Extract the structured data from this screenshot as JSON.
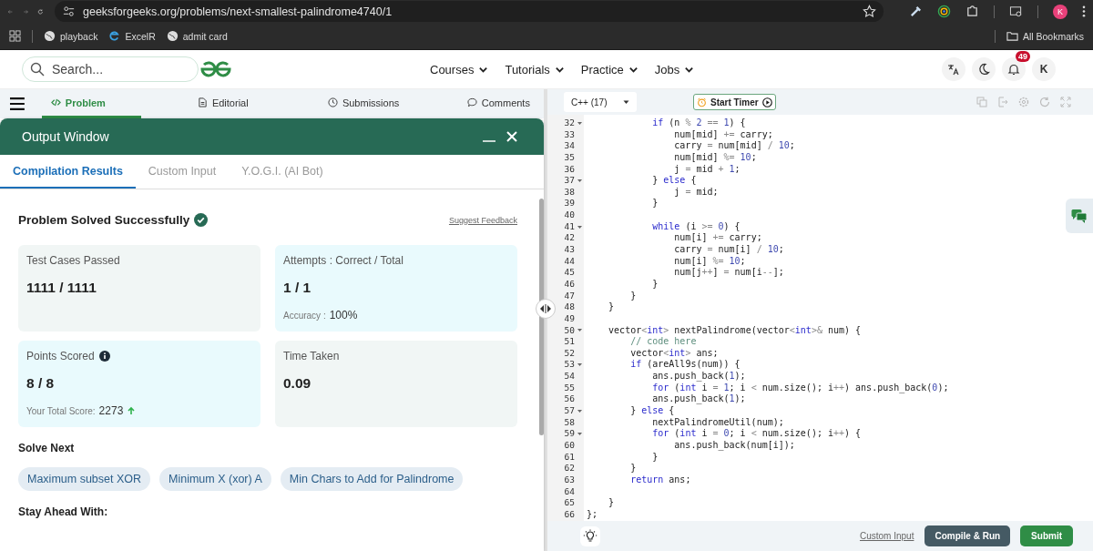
{
  "browser": {
    "url": "geeksforgeeks.org/problems/next-smallest-palindrome4740/1",
    "profile": "K",
    "bookmarks": [
      {
        "label": "playback",
        "kind": "globe"
      },
      {
        "label": "ExcelR",
        "kind": "site"
      },
      {
        "label": "admit card",
        "kind": "globe"
      }
    ],
    "all_bookmarks": "All Bookmarks"
  },
  "header": {
    "search": {
      "placeholder": "Search..."
    },
    "nav": [
      "Courses",
      "Tutorials",
      "Practice",
      "Jobs"
    ],
    "notifications": "49",
    "avatar": "K"
  },
  "problem_tabs": [
    {
      "label": "Problem",
      "kind": "code",
      "selected": true
    },
    {
      "label": "Editorial",
      "kind": "doc",
      "selected": false
    },
    {
      "label": "Submissions",
      "kind": "clock",
      "selected": false
    },
    {
      "label": "Comments",
      "kind": "chat",
      "selected": false
    }
  ],
  "output_window": {
    "title": "Output Window",
    "tabs": [
      {
        "label": "Compilation Results",
        "selected": true
      },
      {
        "label": "Custom Input",
        "selected": false
      },
      {
        "label": "Y.O.G.I. (AI Bot)",
        "selected": false
      }
    ],
    "status": "Problem Solved Successfully",
    "feedback_link": "Suggest Feedback",
    "cards": [
      {
        "label": "Test Cases Passed",
        "value": "1111 / 1111",
        "info": false,
        "rising": false,
        "color": "#f1f6f5"
      },
      {
        "label": "Attempts : Correct / Total",
        "value": "1 / 1",
        "info": false,
        "note_label": "Accuracy :",
        "note_value": "100%",
        "rising": false,
        "color": "#e9fafd"
      },
      {
        "label": "Points Scored",
        "info": true,
        "value": "8 / 8",
        "note_label": "Your Total Score:",
        "note_value": "2273",
        "rising": true,
        "color": "#e9fafd"
      },
      {
        "label": "Time Taken",
        "value": "0.09",
        "info": false,
        "rising": false,
        "color": "#f1f6f5"
      }
    ],
    "solve_next_title": "Solve Next",
    "solve_next": [
      "Maximum subset XOR",
      "Minimum X (xor) A",
      "Min Chars to Add for Palindrome"
    ],
    "stay_ahead": "Stay Ahead With:"
  },
  "editor": {
    "language": "C++ (17)",
    "timer_button": "Start Timer",
    "lines": [
      {
        "n": "32",
        "fold": true,
        "parts": [
          {
            "kw": "            if"
          },
          {
            "tx": " (n "
          },
          {
            "op": "%"
          },
          {
            "num": " 2"
          },
          {
            "op": " =="
          },
          {
            "num": " 1"
          },
          {
            "tx": ") {"
          }
        ]
      },
      {
        "n": "33",
        "fold": false,
        "parts": [
          {
            "tx": "                num[mid] "
          },
          {
            "op": "+="
          },
          {
            "tx": " carry;"
          }
        ]
      },
      {
        "n": "34",
        "fold": false,
        "parts": [
          {
            "tx": "                carry "
          },
          {
            "op": "="
          },
          {
            "tx": " num[mid] "
          },
          {
            "op": "/"
          },
          {
            "num": " 10"
          },
          {
            "tx": ";"
          }
        ]
      },
      {
        "n": "35",
        "fold": false,
        "parts": [
          {
            "tx": "                num[mid] "
          },
          {
            "op": "%="
          },
          {
            "num": " 10"
          },
          {
            "tx": ";"
          }
        ]
      },
      {
        "n": "36",
        "fold": false,
        "parts": [
          {
            "tx": "                j "
          },
          {
            "op": "="
          },
          {
            "tx": " mid "
          },
          {
            "op": "+"
          },
          {
            "num": " 1"
          },
          {
            "tx": ";"
          }
        ]
      },
      {
        "n": "37",
        "fold": true,
        "parts": [
          {
            "tx": "            } "
          },
          {
            "kw": "else"
          },
          {
            "tx": " {"
          }
        ]
      },
      {
        "n": "38",
        "fold": false,
        "parts": [
          {
            "tx": "                j "
          },
          {
            "op": "="
          },
          {
            "tx": " mid;"
          }
        ]
      },
      {
        "n": "39",
        "fold": false,
        "parts": [
          {
            "tx": "            }"
          }
        ]
      },
      {
        "n": "40",
        "fold": false
      },
      {
        "n": "41",
        "fold": true,
        "parts": [
          {
            "kw": "            while"
          },
          {
            "tx": " (i "
          },
          {
            "op": ">="
          },
          {
            "num": " 0"
          },
          {
            "tx": ") {"
          }
        ]
      },
      {
        "n": "42",
        "fold": false,
        "parts": [
          {
            "tx": "                num[i] "
          },
          {
            "op": "+="
          },
          {
            "tx": " carry;"
          }
        ]
      },
      {
        "n": "43",
        "fold": false,
        "parts": [
          {
            "tx": "                carry "
          },
          {
            "op": "="
          },
          {
            "tx": " num[i] "
          },
          {
            "op": "/"
          },
          {
            "num": " 10"
          },
          {
            "tx": ";"
          }
        ]
      },
      {
        "n": "44",
        "fold": false,
        "parts": [
          {
            "tx": "                num[i] "
          },
          {
            "op": "%="
          },
          {
            "num": " 10"
          },
          {
            "tx": ";"
          }
        ]
      },
      {
        "n": "45",
        "fold": false,
        "parts": [
          {
            "tx": "                num[j"
          },
          {
            "op": "++"
          },
          {
            "tx": "] "
          },
          {
            "op": "="
          },
          {
            "tx": " num[i"
          },
          {
            "op": "--"
          },
          {
            "tx": "];"
          }
        ]
      },
      {
        "n": "46",
        "fold": false,
        "parts": [
          {
            "tx": "            }"
          }
        ]
      },
      {
        "n": "47",
        "fold": false,
        "parts": [
          {
            "tx": "        }"
          }
        ]
      },
      {
        "n": "48",
        "fold": false,
        "parts": [
          {
            "tx": "    }"
          }
        ]
      },
      {
        "n": "49",
        "fold": false
      },
      {
        "n": "50",
        "fold": true,
        "parts": [
          {
            "tx": "    vector"
          },
          {
            "op": "<"
          },
          {
            "kw": "int"
          },
          {
            "op": ">"
          },
          {
            "tx": " nextPalindrome(vector"
          },
          {
            "op": "<"
          },
          {
            "kw": "int"
          },
          {
            "op": ">&"
          },
          {
            "tx": " num) {"
          }
        ]
      },
      {
        "n": "51",
        "fold": false,
        "parts": [
          {
            "cm": "        // code here"
          }
        ]
      },
      {
        "n": "52",
        "fold": false,
        "parts": [
          {
            "tx": "        vector"
          },
          {
            "op": "<"
          },
          {
            "kw": "int"
          },
          {
            "op": ">"
          },
          {
            "tx": " ans;"
          }
        ]
      },
      {
        "n": "53",
        "fold": true,
        "parts": [
          {
            "kw": "        if"
          },
          {
            "tx": " (areAll9s(num)) {"
          }
        ]
      },
      {
        "n": "54",
        "fold": false,
        "parts": [
          {
            "tx": "            ans.push_back("
          },
          {
            "num": "1"
          },
          {
            "tx": ");"
          }
        ]
      },
      {
        "n": "55",
        "fold": false,
        "parts": [
          {
            "kw": "            for"
          },
          {
            "tx": " ("
          },
          {
            "kw": "int"
          },
          {
            "tx": " i "
          },
          {
            "op": "="
          },
          {
            "num": " 1"
          },
          {
            "tx": "; i "
          },
          {
            "op": "<"
          },
          {
            "tx": " num.size(); i"
          },
          {
            "op": "++"
          },
          {
            "tx": ") ans.push_back("
          },
          {
            "num": "0"
          },
          {
            "tx": ");"
          }
        ]
      },
      {
        "n": "56",
        "fold": false,
        "parts": [
          {
            "tx": "            ans.push_back("
          },
          {
            "num": "1"
          },
          {
            "tx": ");"
          }
        ]
      },
      {
        "n": "57",
        "fold": true,
        "parts": [
          {
            "tx": "        } "
          },
          {
            "kw": "else"
          },
          {
            "tx": " {"
          }
        ]
      },
      {
        "n": "58",
        "fold": false,
        "parts": [
          {
            "tx": "            nextPalindromeUtil(num);"
          }
        ]
      },
      {
        "n": "59",
        "fold": true,
        "parts": [
          {
            "kw": "            for"
          },
          {
            "tx": " ("
          },
          {
            "kw": "int"
          },
          {
            "tx": " i "
          },
          {
            "op": "="
          },
          {
            "num": " 0"
          },
          {
            "tx": "; i "
          },
          {
            "op": "<"
          },
          {
            "tx": " num.size(); i"
          },
          {
            "op": "++"
          },
          {
            "tx": ") {"
          }
        ]
      },
      {
        "n": "60",
        "fold": false,
        "parts": [
          {
            "tx": "                ans.push_back(num[i]);"
          }
        ]
      },
      {
        "n": "61",
        "fold": false,
        "parts": [
          {
            "tx": "            }"
          }
        ]
      },
      {
        "n": "62",
        "fold": false,
        "parts": [
          {
            "tx": "        }"
          }
        ]
      },
      {
        "n": "63",
        "fold": false,
        "parts": [
          {
            "kw": "        return"
          },
          {
            "tx": " ans;"
          }
        ]
      },
      {
        "n": "64",
        "fold": false
      },
      {
        "n": "65",
        "fold": false,
        "parts": [
          {
            "tx": "    }"
          }
        ]
      },
      {
        "n": "66",
        "fold": false,
        "parts": [
          {
            "tx": "};"
          }
        ]
      }
    ],
    "custom_input": "Custom Input",
    "compile_button": "Compile & Run",
    "submit_button": "Submit"
  }
}
